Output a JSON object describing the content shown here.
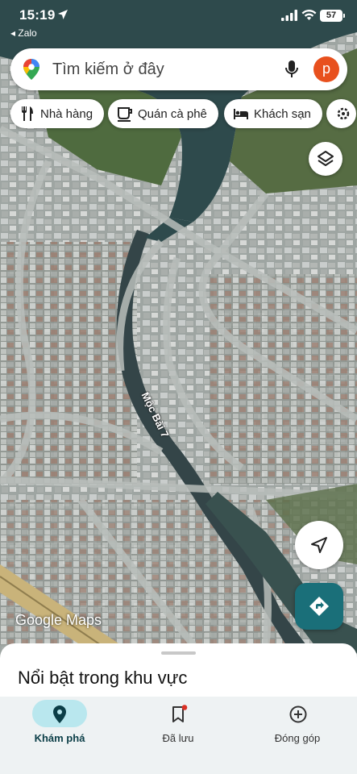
{
  "status_bar": {
    "time": "15:19",
    "back_app": "◂ Zalo",
    "battery": "57"
  },
  "search": {
    "placeholder": "Tìm kiếm ở đây",
    "avatar_letter": "p"
  },
  "chips": [
    {
      "label": "Nhà hàng",
      "icon": "fork-knife-icon"
    },
    {
      "label": "Quán cà phê",
      "icon": "coffee-cup-icon"
    },
    {
      "label": "Khách sạn",
      "icon": "bed-icon"
    },
    {
      "label": "",
      "icon": "more-icon"
    }
  ],
  "map": {
    "street_label": "Mộc Bài 7",
    "watermark": "Google Maps"
  },
  "sheet": {
    "title": "Nổi bật trong khu vực"
  },
  "nav": {
    "items": [
      {
        "label": "Khám phá",
        "icon": "explore-pin-icon",
        "active": true
      },
      {
        "label": "Đã lưu",
        "icon": "bookmark-icon",
        "active": false
      },
      {
        "label": "Đóng góp",
        "icon": "add-circle-icon",
        "active": false
      }
    ]
  },
  "colors": {
    "accent": "#1a6f79",
    "avatar": "#e8501d",
    "nav_active_pill": "#b9e7ee",
    "notification_dot": "#d93025"
  }
}
